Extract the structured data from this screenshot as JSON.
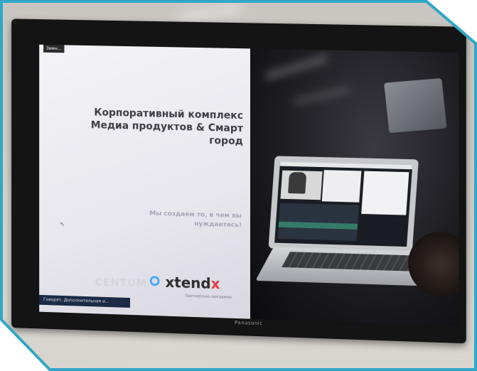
{
  "screen": {
    "headline": "Корпоративный комплекс Медиа продуктов & Смарт город",
    "tagline": "Мы создаем то, в чем вы нуждаетесь!",
    "logos": {
      "centum": "CENTUM",
      "xtend": "xtend",
      "xtend_x": "x",
      "sub": "Партнерские программы"
    },
    "bottom_button": "Говорят, Дополнительная и...",
    "panel_tab": "Зимн..."
  },
  "tv": {
    "brand": "Panasonic"
  },
  "colors": {
    "frame_border": "#2fa7c7",
    "accent_blue": "#4aa8ff",
    "xtend_red": "#e53d49"
  }
}
